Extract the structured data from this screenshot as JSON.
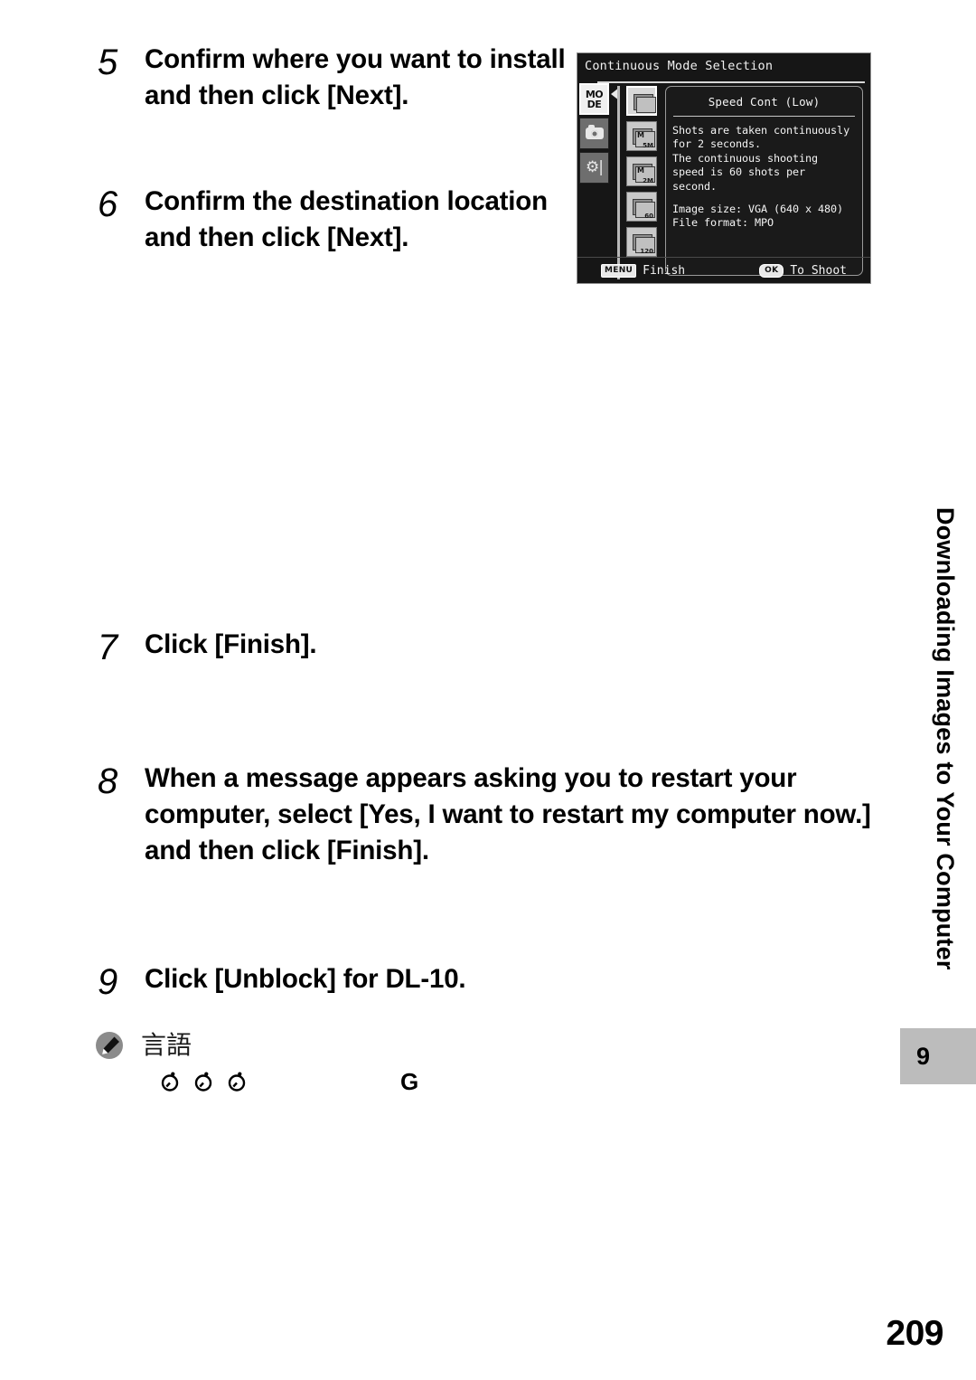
{
  "page": {
    "number": "209",
    "chapter_tab": "9",
    "running_head": "Downloading Images to Your Computer"
  },
  "steps": [
    {
      "number": "5",
      "text": "Confirm where you want to install and then click [Next]."
    },
    {
      "number": "6",
      "text": "Confirm the destination location and then click [Next]."
    },
    {
      "number": "7",
      "text": "Click [Finish]."
    },
    {
      "number": "8",
      "text": "When a message appears asking you to restart your computer, select [Yes, I want to restart my computer now.] and then click [Finish]."
    },
    {
      "number": "9",
      "text": "Click [Unblock] for DL-10."
    }
  ],
  "memo": {
    "icon": "pencil-memo-icon",
    "title": "言語",
    "symbols": [
      "self-timer-icon",
      "self-timer-icon",
      "self-timer-icon"
    ],
    "trailing_glyph": "G"
  },
  "lcd": {
    "title": "Continuous Mode Selection",
    "tabs": [
      {
        "name": "mode-tab",
        "line1": "MO",
        "line2": "DE",
        "active": true
      },
      {
        "name": "shooting-tab",
        "glyph": "camera",
        "active": false
      },
      {
        "name": "setup-tab",
        "glyph": "tools",
        "active": false
      }
    ],
    "mode_icons": [
      {
        "name": "speed-cont-low-icon",
        "label": "",
        "prefix": "",
        "selected": true
      },
      {
        "name": "cont-5m-icon",
        "label": "5M",
        "prefix": "M",
        "selected": false
      },
      {
        "name": "cont-2m-icon",
        "label": "2M",
        "prefix": "M",
        "selected": false
      },
      {
        "name": "cont-60-icon",
        "label": "60",
        "prefix": "",
        "selected": false
      },
      {
        "name": "cont-120-icon",
        "label": "120",
        "prefix": "",
        "selected": false
      }
    ],
    "panel": {
      "heading": "Speed Cont (Low)",
      "description": "Shots are taken continuously for 2 seconds.\nThe continuous shooting speed is 60 shots per second.",
      "specs": "Image size: VGA (640 x 480)\nFile format: MPO"
    },
    "footer": {
      "menu_key": "MENU",
      "menu_label": "Finish",
      "ok_key": "OK",
      "ok_label": "To Shoot"
    }
  },
  "colors": {
    "lcd_background": "#161616",
    "lcd_panel": "#1a1a1a",
    "chapter_tab": "#bcbcbc",
    "text": "#000000"
  }
}
